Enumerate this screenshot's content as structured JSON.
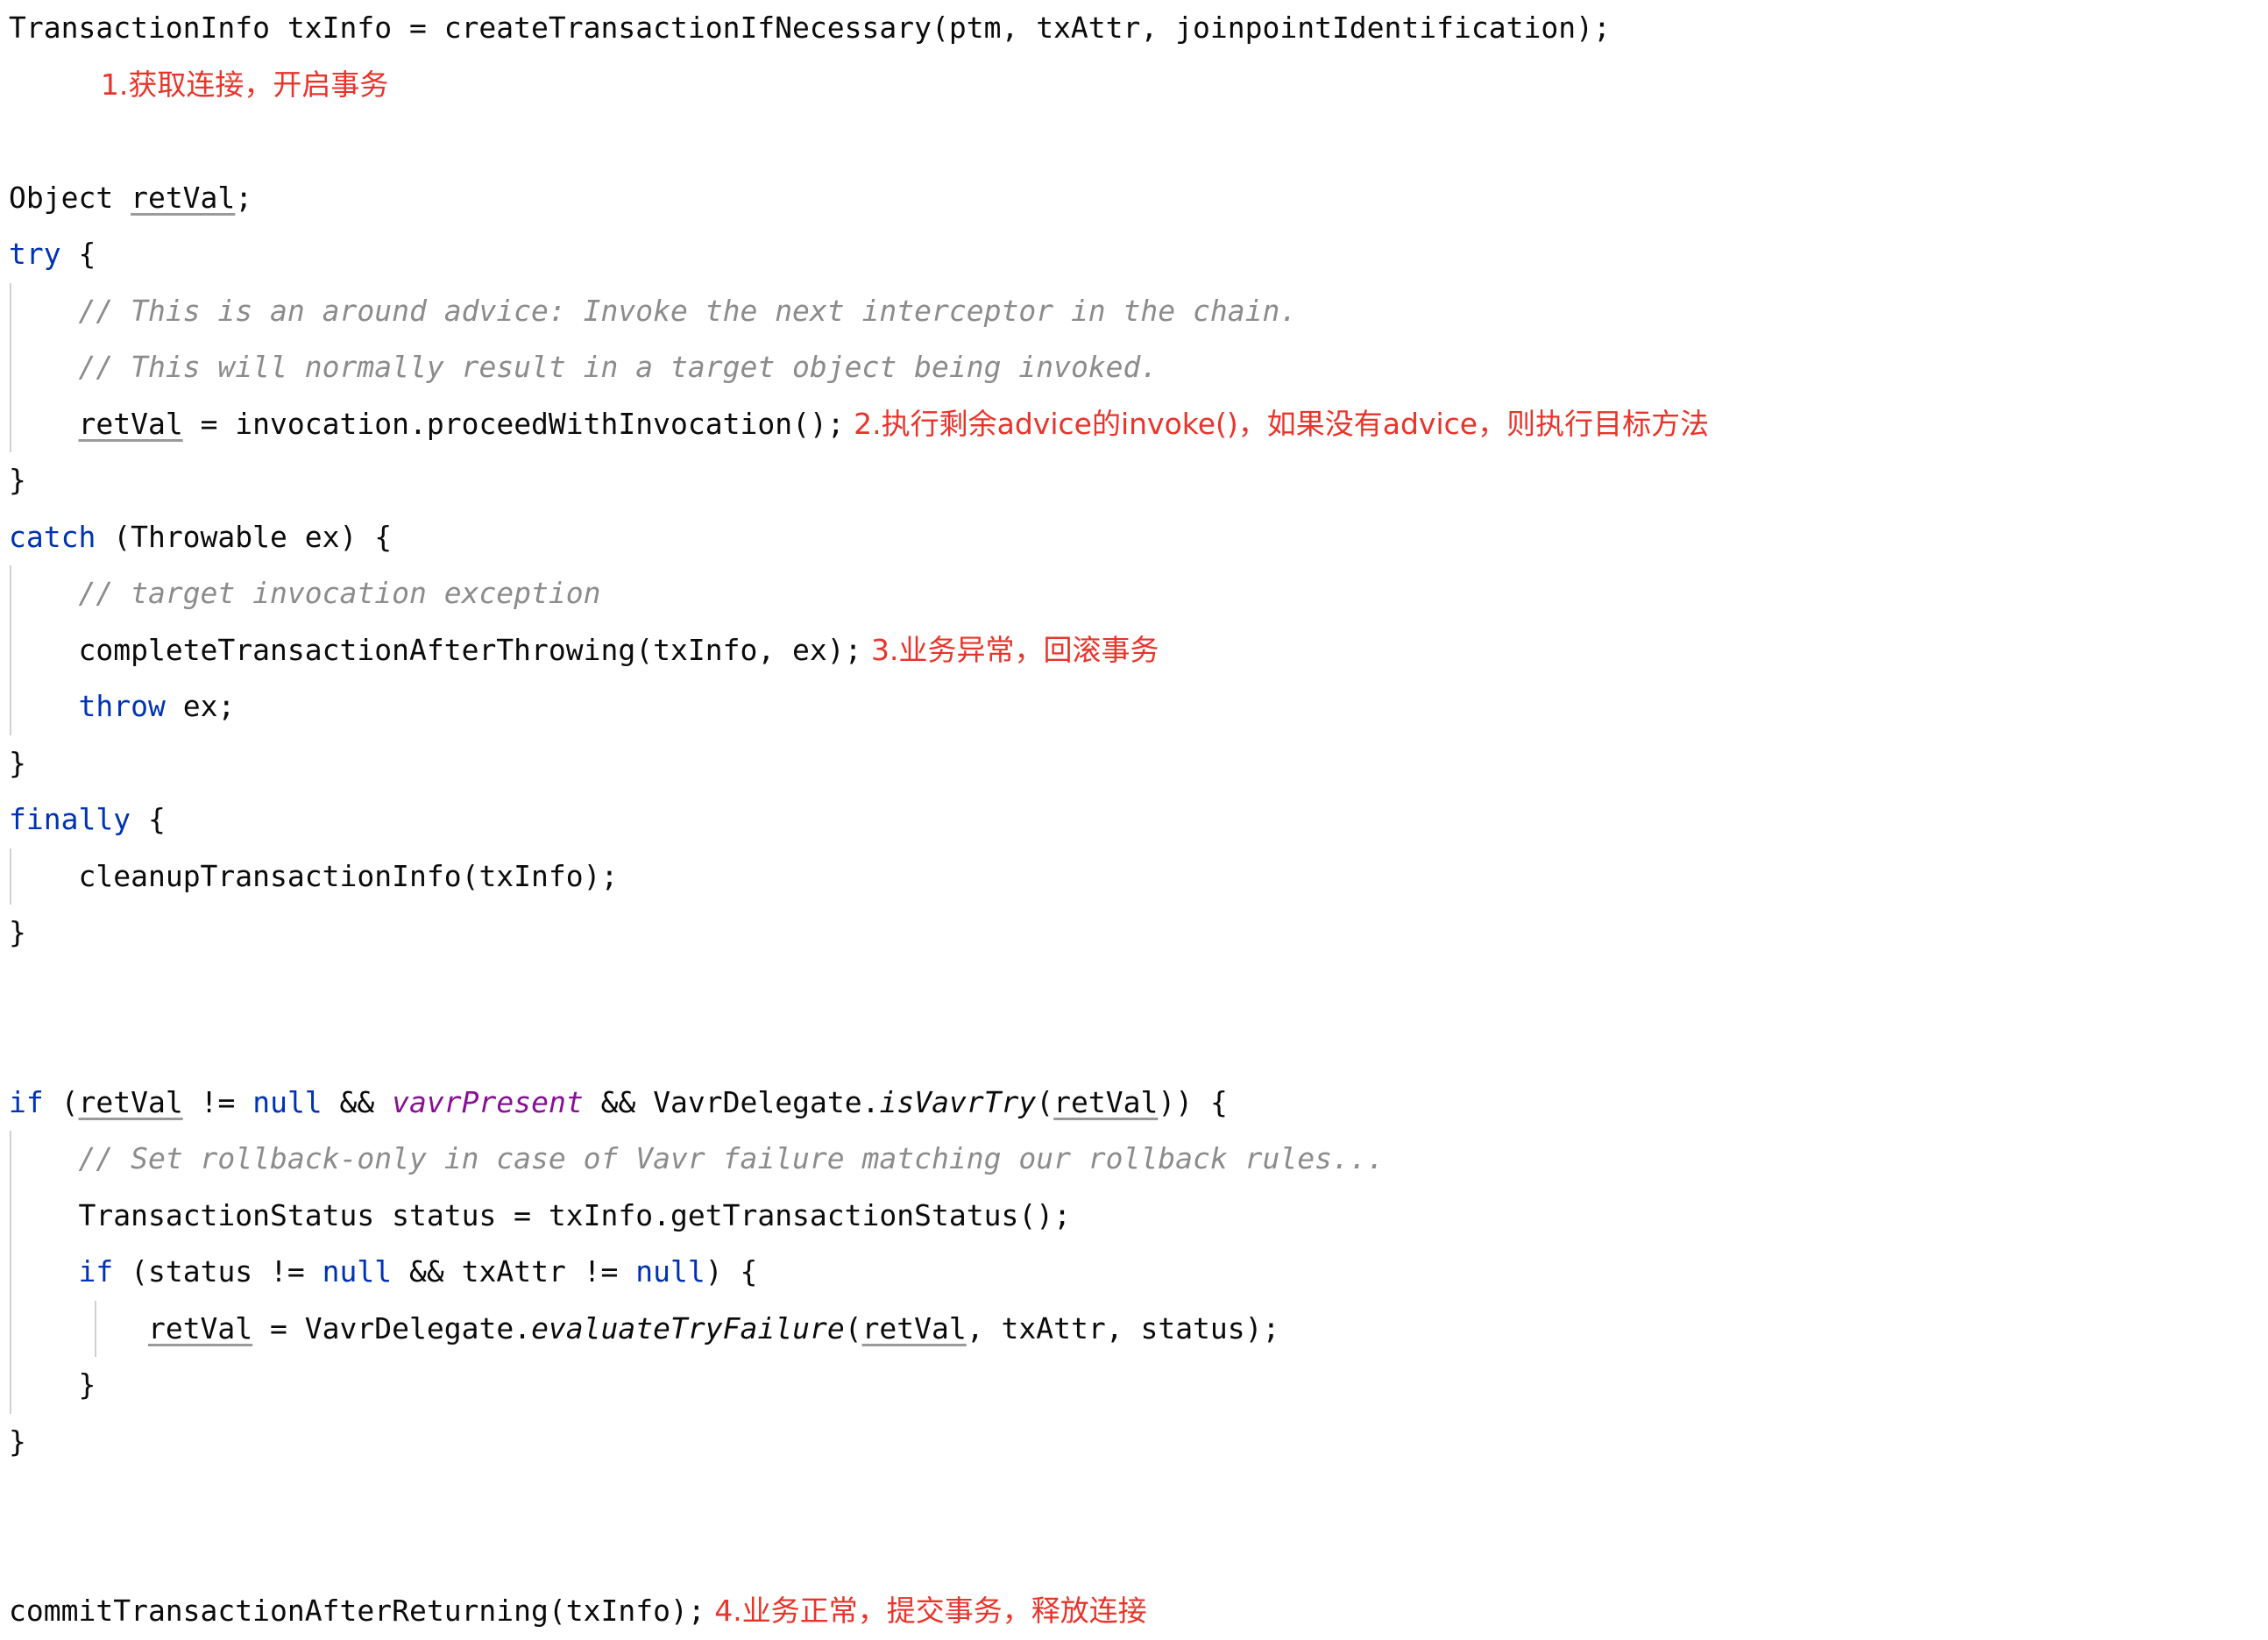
{
  "document": {
    "kind": "java-source-snippet",
    "language": "Java",
    "background_color": "#ffffff",
    "colors": {
      "text": "#0b0b0b",
      "keyword": "#0033b3",
      "comment": "#8c8c8c",
      "field": "#871094",
      "annotation_red": "#e8342a",
      "indent_guide": "#d0d0d0"
    }
  },
  "annotations": [
    {
      "id": "anno-1",
      "text": "1.获取连接，开启事务"
    },
    {
      "id": "anno-2",
      "text": "2.执行剩余advice的invoke()，如果没有advice，则执行目标方法"
    },
    {
      "id": "anno-3",
      "text": "3.业务异常，回滚事务"
    },
    {
      "id": "anno-4",
      "text": "4.业务正常，提交事务，释放连接"
    }
  ],
  "lines": [
    {
      "id": "line-1",
      "indent": 0,
      "tokens": [
        {
          "t": "TransactionInfo txInfo = createTransactionIfNecessary(ptm, txAttr, joinpointIdentification);",
          "s": "plain"
        }
      ]
    },
    {
      "id": "line-2-annotation",
      "indent": 0,
      "annotation_only": true,
      "annotation": "1.获取连接，开启事务"
    },
    {
      "id": "line-3",
      "indent": 0,
      "blank": true
    },
    {
      "id": "line-4",
      "indent": 0,
      "tokens": [
        {
          "t": "Object ",
          "s": "plain"
        },
        {
          "t": "retVal",
          "s": "local"
        },
        {
          "t": ";",
          "s": "plain"
        }
      ]
    },
    {
      "id": "line-5",
      "indent": 0,
      "tokens": [
        {
          "t": "try",
          "s": "kw"
        },
        {
          "t": " {",
          "s": "plain"
        }
      ]
    },
    {
      "id": "line-6",
      "indent": 1,
      "tokens": [
        {
          "t": "// This is an around advice: Invoke the next interceptor in the chain.",
          "s": "cmt"
        }
      ]
    },
    {
      "id": "line-7",
      "indent": 1,
      "tokens": [
        {
          "t": "// This will normally result in a target object being invoked.",
          "s": "cmt"
        }
      ]
    },
    {
      "id": "line-8",
      "indent": 1,
      "tokens": [
        {
          "t": "retVal",
          "s": "local"
        },
        {
          "t": " = invocation.proceedWithInvocation();",
          "s": "plain"
        }
      ],
      "annotation": "2.执行剩余advice的invoke()，如果没有advice，则执行目标方法"
    },
    {
      "id": "line-9",
      "indent": 0,
      "tokens": [
        {
          "t": "}",
          "s": "plain"
        }
      ]
    },
    {
      "id": "line-10",
      "indent": 0,
      "tokens": [
        {
          "t": "catch",
          "s": "kw"
        },
        {
          "t": " (Throwable ex) {",
          "s": "plain"
        }
      ]
    },
    {
      "id": "line-11",
      "indent": 1,
      "tokens": [
        {
          "t": "// target invocation exception",
          "s": "cmt"
        }
      ]
    },
    {
      "id": "line-12",
      "indent": 1,
      "tokens": [
        {
          "t": "completeTransactionAfterThrowing(txInfo, ex);",
          "s": "plain"
        }
      ],
      "annotation": "3.业务异常，回滚事务"
    },
    {
      "id": "line-13",
      "indent": 1,
      "tokens": [
        {
          "t": "throw",
          "s": "kw"
        },
        {
          "t": " ex;",
          "s": "plain"
        }
      ]
    },
    {
      "id": "line-14",
      "indent": 0,
      "tokens": [
        {
          "t": "}",
          "s": "plain"
        }
      ]
    },
    {
      "id": "line-15",
      "indent": 0,
      "tokens": [
        {
          "t": "finally",
          "s": "kw"
        },
        {
          "t": " {",
          "s": "plain"
        }
      ]
    },
    {
      "id": "line-16",
      "indent": 1,
      "tokens": [
        {
          "t": "cleanupTransactionInfo(txInfo);",
          "s": "plain"
        }
      ]
    },
    {
      "id": "line-17",
      "indent": 0,
      "tokens": [
        {
          "t": "}",
          "s": "plain"
        }
      ]
    },
    {
      "id": "line-18",
      "indent": 0,
      "blank": true
    },
    {
      "id": "line-19",
      "indent": 0,
      "blank": true
    },
    {
      "id": "line-20",
      "indent": 0,
      "tokens": [
        {
          "t": "if",
          "s": "kw"
        },
        {
          "t": " (",
          "s": "plain"
        },
        {
          "t": "retVal",
          "s": "local"
        },
        {
          "t": " != ",
          "s": "plain"
        },
        {
          "t": "null",
          "s": "kw"
        },
        {
          "t": " && ",
          "s": "plain"
        },
        {
          "t": "vavrPresent",
          "s": "field"
        },
        {
          "t": " && VavrDelegate.",
          "s": "plain"
        },
        {
          "t": "isVavrTry",
          "s": "static"
        },
        {
          "t": "(",
          "s": "plain"
        },
        {
          "t": "retVal",
          "s": "local"
        },
        {
          "t": ")) {",
          "s": "plain"
        }
      ]
    },
    {
      "id": "line-21",
      "indent": 1,
      "tokens": [
        {
          "t": "// Set rollback-only in case of Vavr failure matching our rollback rules...",
          "s": "cmt"
        }
      ]
    },
    {
      "id": "line-22",
      "indent": 1,
      "tokens": [
        {
          "t": "TransactionStatus status = txInfo.getTransactionStatus();",
          "s": "plain"
        }
      ]
    },
    {
      "id": "line-23",
      "indent": 1,
      "tokens": [
        {
          "t": "if",
          "s": "kw"
        },
        {
          "t": " (status != ",
          "s": "plain"
        },
        {
          "t": "null",
          "s": "kw"
        },
        {
          "t": " && txAttr != ",
          "s": "plain"
        },
        {
          "t": "null",
          "s": "kw"
        },
        {
          "t": ") {",
          "s": "plain"
        }
      ]
    },
    {
      "id": "line-24",
      "indent": 2,
      "tokens": [
        {
          "t": "retVal",
          "s": "local"
        },
        {
          "t": " = VavrDelegate.",
          "s": "plain"
        },
        {
          "t": "evaluateTryFailure",
          "s": "static"
        },
        {
          "t": "(",
          "s": "plain"
        },
        {
          "t": "retVal",
          "s": "local"
        },
        {
          "t": ", txAttr, status);",
          "s": "plain"
        }
      ]
    },
    {
      "id": "line-25",
      "indent": 1,
      "tokens": [
        {
          "t": "}",
          "s": "plain"
        }
      ]
    },
    {
      "id": "line-26",
      "indent": 0,
      "tokens": [
        {
          "t": "}",
          "s": "plain"
        }
      ]
    },
    {
      "id": "line-27",
      "indent": 0,
      "blank": true
    },
    {
      "id": "line-28",
      "indent": 0,
      "blank": true
    },
    {
      "id": "line-29",
      "indent": 0,
      "tokens": [
        {
          "t": "commitTransactionAfterReturning(txInfo);",
          "s": "plain"
        }
      ],
      "annotation": "4.业务正常，提交事务，释放连接"
    }
  ]
}
